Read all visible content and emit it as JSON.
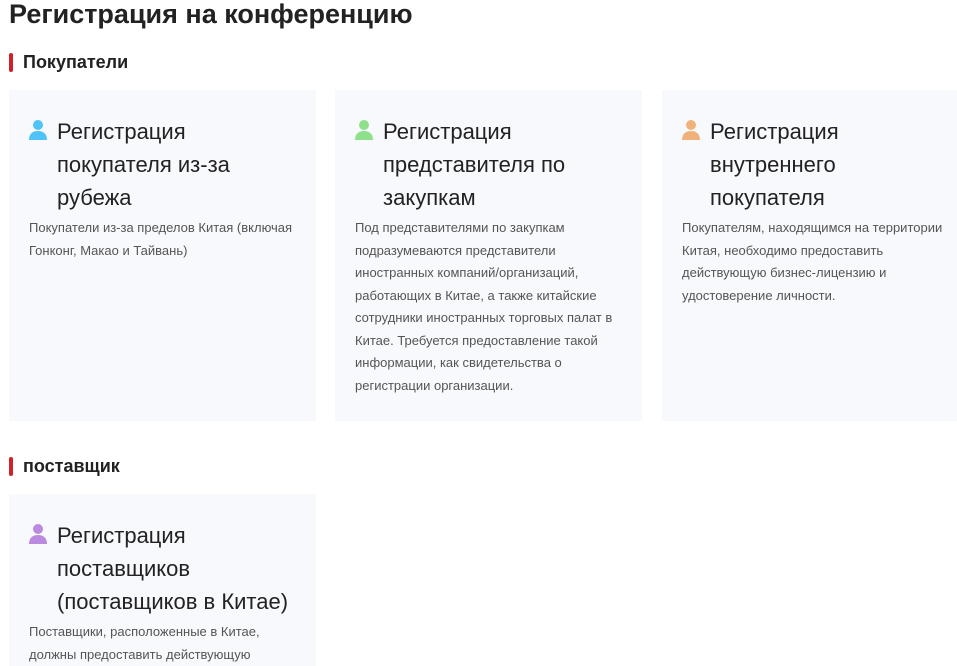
{
  "page": {
    "title": "Регистрация на конференцию"
  },
  "sections": [
    {
      "heading": "Покупатели",
      "cards": [
        {
          "icon": "user-icon",
          "icon_color": "#4fc3f7",
          "title": "Регистрация покупателя из-за рубежа",
          "description": "Покупатели из-за пределов Китая (включая Гонконг, Макао и Тайвань)"
        },
        {
          "icon": "user-icon",
          "icon_color": "#8ee08a",
          "title": "Регистрация представителя по закупкам",
          "description": "Под представителями по закупкам подразумеваются представители иностранных компаний/организаций, работающих в Китае, а также китайские сотрудники иностранных торговых палат в Китае. Требуется предоставление такой информации, как свидетельства о регистрации организации."
        },
        {
          "icon": "user-icon",
          "icon_color": "#f0b27a",
          "title": "Регистрация внутреннего покупателя",
          "description": "Покупателям, находящимся на территории Китая, необходимо предоставить действующую бизнес-лицензию и удостоверение личности."
        }
      ]
    },
    {
      "heading": "поставщик",
      "cards": [
        {
          "icon": "user-icon",
          "icon_color": "#b98ae0",
          "title": "Регистрация поставщиков (поставщиков в Китае)",
          "description": "Поставщики, расположенные в Китае, должны предоставить действующую"
        }
      ]
    }
  ]
}
